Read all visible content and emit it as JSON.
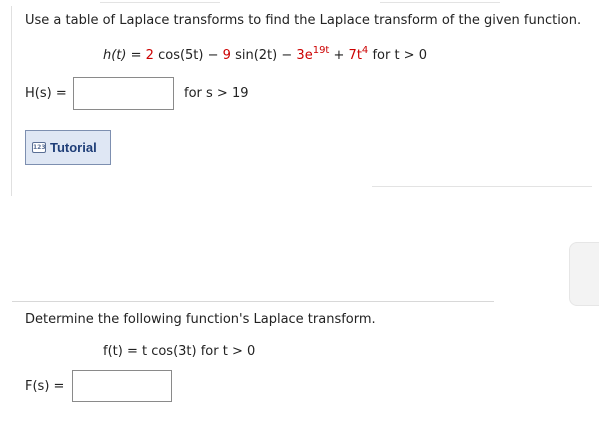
{
  "q1": {
    "instruction": "Use a table of Laplace transforms to find the Laplace transform of the given function.",
    "function_label": "h(t)",
    "eq": "=",
    "c1": "2",
    "term1": "cos(5t)",
    "minus1": "−",
    "c2": "9",
    "term2": "sin(2t)",
    "minus2": "−",
    "c3": "3e",
    "c3_exp": "19t",
    "plus": "+",
    "c4": "7t",
    "c4_exp": "4",
    "domain": "for t > 0",
    "answer_label": "H(s) =",
    "answer_value": "",
    "answer_domain": "for s > 19",
    "tutorial_icon": "123",
    "tutorial_label": "Tutorial"
  },
  "q2": {
    "instruction": "Determine the following function's Laplace transform.",
    "function_text": "f(t) = t cos(3t) for t > 0",
    "answer_label": "F(s) =",
    "answer_value": ""
  },
  "colors": {
    "emphasis": "#cc0000",
    "button_bg": "#dfe7f4",
    "button_text": "#1f3e78"
  }
}
